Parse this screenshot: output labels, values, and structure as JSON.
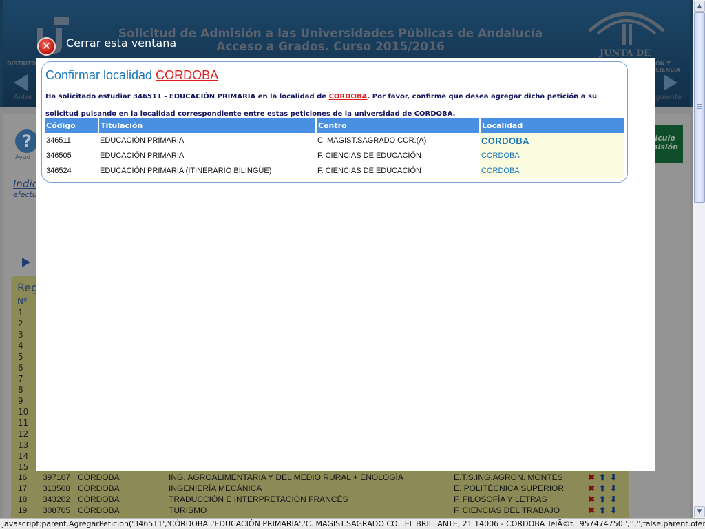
{
  "background": {
    "title_line1": "Solicitud de Admisión a las Universidades Públicas de Andalucía",
    "title_line2": "Acceso a Grados. Curso 2015/2016",
    "junta_label": "JUNTA DE ANDALUCIA",
    "distrito_label": "DISTRITO",
    "right_label": "ÓN Y CIENCIA",
    "prev_label": "Anter",
    "next_label": "guiente",
    "help_label": "Ayud",
    "green_button_label": "álculo misión",
    "indi_label": "Indic",
    "efect_label": "efectu",
    "reg_label": "Reg",
    "num_header": "Nº",
    "row_numbers": [
      "1",
      "2",
      "3",
      "4",
      "5",
      "6",
      "7",
      "8",
      "9",
      "10",
      "11",
      "12",
      "13",
      "14",
      "15"
    ],
    "rows": [
      {
        "num": "16",
        "code": "397107",
        "loc": "CÓRDOBA",
        "title": "ING. AGROALIMENTARIA Y DEL MEDIO RURAL + ENOLOGÍA",
        "centro": "E.T.S.ING.AGRON. MONTES"
      },
      {
        "num": "17",
        "code": "313508",
        "loc": "CÓRDOBA",
        "title": "INGENIERÍA MECÁNICA",
        "centro": "E. POLITÉCNICA SUPERIOR"
      },
      {
        "num": "18",
        "code": "343202",
        "loc": "CÓRDOBA",
        "title": "TRADUCCIÓN E INTERPRETACIÓN FRANCÉS",
        "centro": "F. FILOSOFÍA Y LETRAS"
      },
      {
        "num": "19",
        "code": "308705",
        "loc": "CÓRDOBA",
        "title": "TURISMO",
        "centro": "F. CIENCIAS DEL TRABAJO"
      }
    ]
  },
  "close": {
    "label": "Cerrar esta ventana",
    "icon": "close-x-icon"
  },
  "modal": {
    "title_prefix": "Confirmar localidad ",
    "title_locality": "CORDOBA",
    "message": {
      "part1": "Ha solicitado estudiar 346511 - EDUCACIÓN PRIMARIA en la localidad de ",
      "locality": "CORDOBA",
      "part2": ". Por favor, confirme que desea agregar dicha petición a su solicitud pulsando en la localidad correspondiente entre estas peticiones de la universidad de CÓRDOBA."
    },
    "table": {
      "headers": [
        "Código",
        "Titulación",
        "Centro",
        "Localidad"
      ],
      "rows": [
        {
          "codigo": "346511",
          "titulacion": "EDUCACIÓN PRIMARIA",
          "centro": "C. MAGIST.SAGRADO COR.(A)",
          "localidad": "CORDOBA"
        },
        {
          "codigo": "346505",
          "titulacion": "EDUCACIÓN PRIMARIA",
          "centro": "F. CIENCIAS DE EDUCACIÓN",
          "localidad": "CORDOBA"
        },
        {
          "codigo": "346524",
          "titulacion": "EDUCACIÓN PRIMARIA (ITINERARIO BILINGÜE)",
          "centro": "F. CIENCIAS DE EDUCACIÓN",
          "localidad": "CORDOBA"
        }
      ]
    }
  },
  "statusbar": {
    "text": "javascript:parent.AgregarPeticion('346511','CÓRDOBA','EDUCACIÓN PRIMARIA','C. MAGIST.SAGRADO CO...EL BRILLANTE, 21  14006 - CORDOBA  TelÃ©f.: 957474750  ','','',false,parent.oferta[346511],'N')"
  },
  "colors": {
    "accent": "#1a77b8",
    "locality_red": "#e01e1e",
    "table_header": "#4a90e2",
    "locality_cell_bg": "#fbfbe0",
    "message_text": "#15175e"
  }
}
